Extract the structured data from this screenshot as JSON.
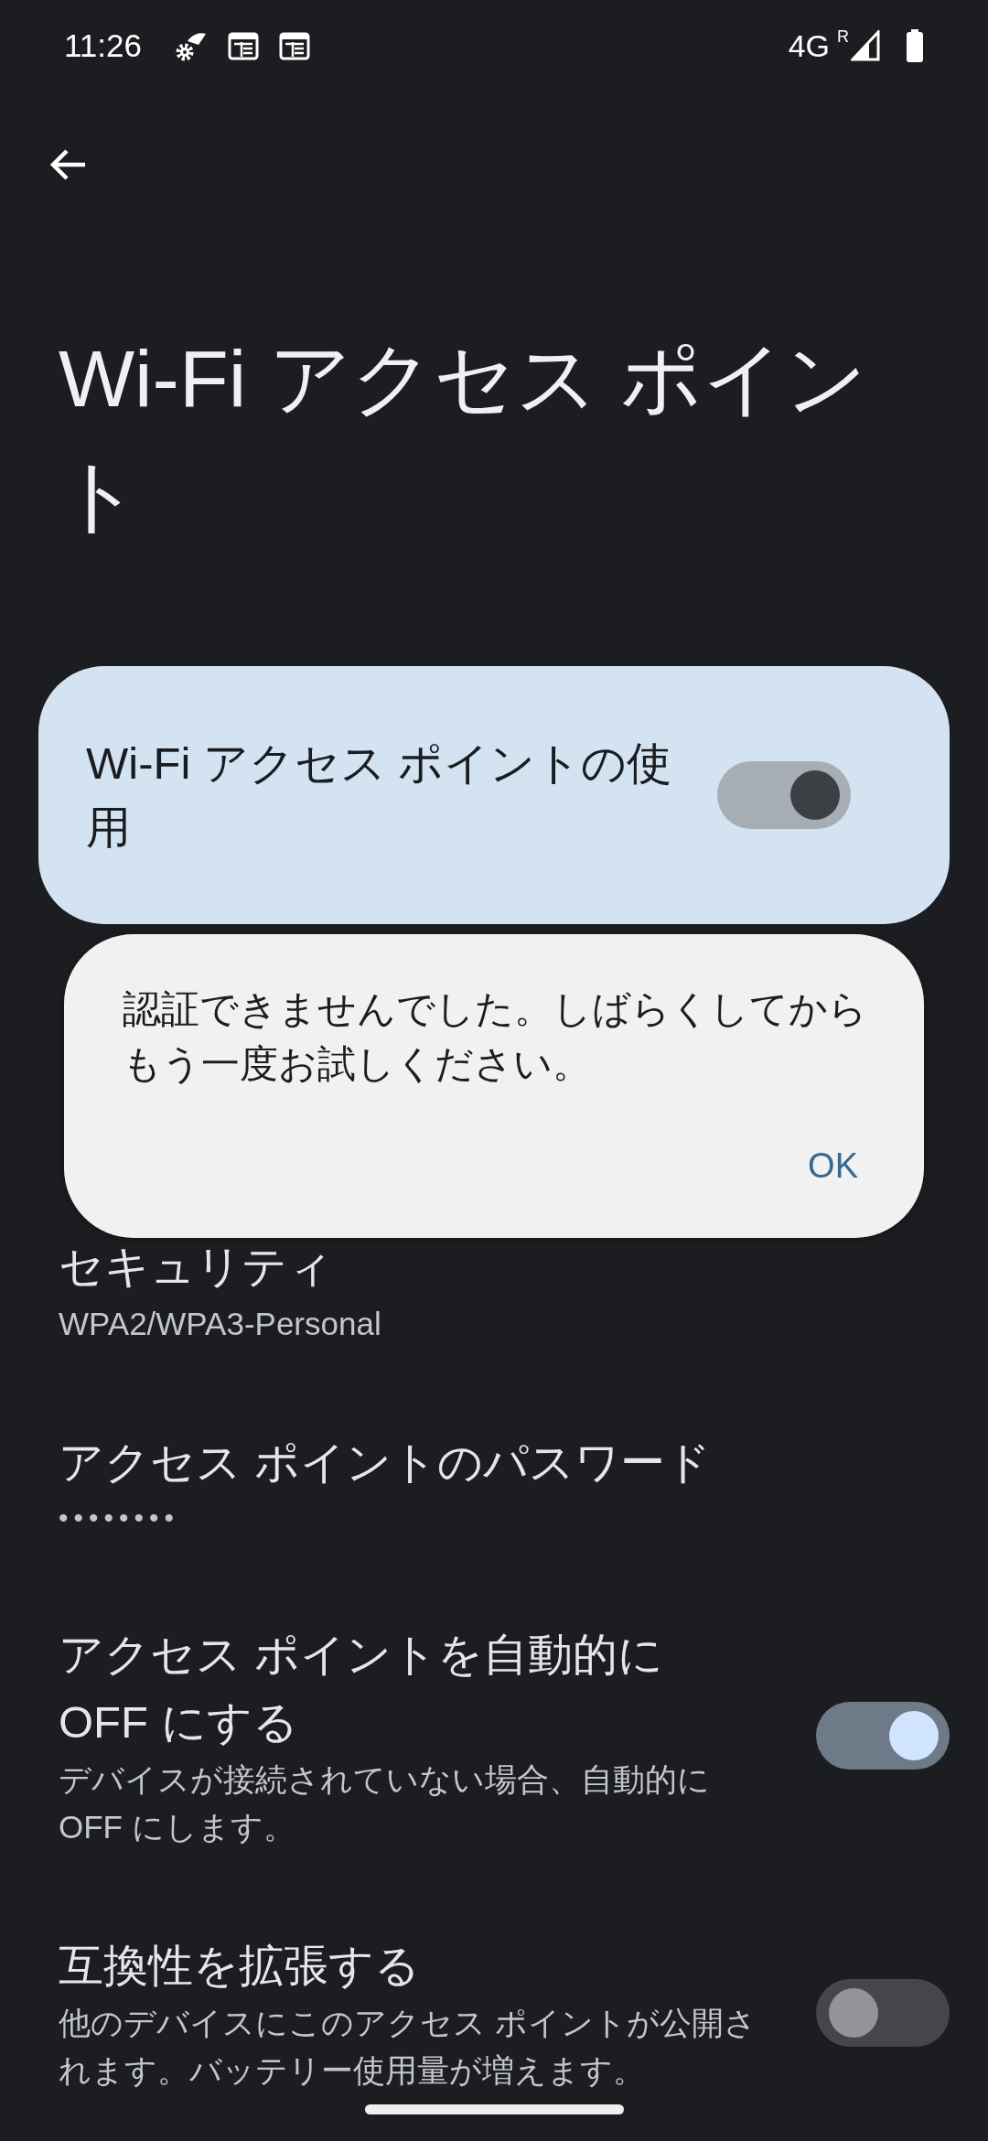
{
  "status_bar": {
    "time": "11:26",
    "network": "4G",
    "roaming": "R"
  },
  "title": "Wi-Fi アクセス ポイント",
  "main_switch": {
    "label": "Wi-Fi アクセス ポイントの使用",
    "on": true,
    "disabled": true
  },
  "settings": [
    {
      "kind": "text",
      "title": "セキュリティ",
      "summary": "WPA2/WPA3-Personal"
    },
    {
      "kind": "password",
      "title": "アクセス ポイントのパスワード",
      "summary": "••••••••"
    },
    {
      "kind": "toggle",
      "title": "アクセス ポイントを自動的に OFF にする",
      "summary": "デバイスが接続されていない場合、自動的に OFF にします。",
      "on": true
    },
    {
      "kind": "toggle",
      "title": "互換性を拡張する",
      "summary": "他のデバイスにこのアクセス ポイントが公開されます。バッテリー使用量が増えます。",
      "on": false
    }
  ],
  "toast": {
    "message": "認証できませんでした。しばらくしてからもう一度お試しください。",
    "button": "OK"
  }
}
